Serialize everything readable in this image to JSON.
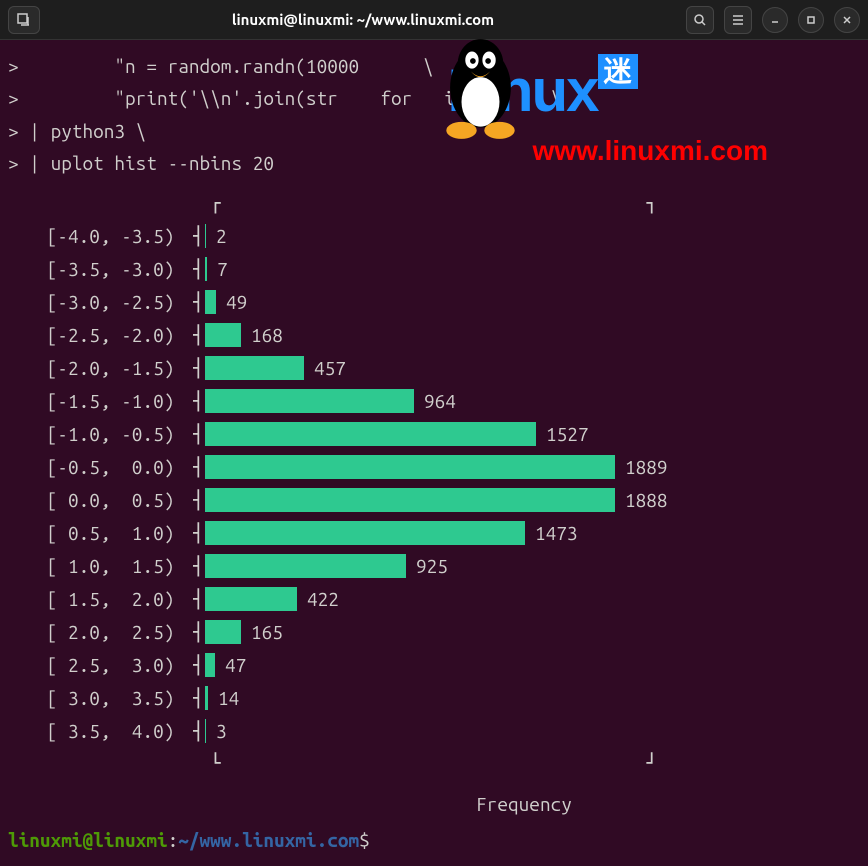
{
  "titlebar": {
    "title": "linuxmi@linuxmi: ~/www.linuxmi.com"
  },
  "watermark": {
    "text_linux": "Linux",
    "text_mi": "迷",
    "url": "www.linuxmi.com"
  },
  "commands": {
    "line1_prefix": ">         ",
    "line1": "\"n = random.randn(10000      \\",
    "line2_prefix": ">         ",
    "line2": "\"print('\\\\n'.join(str    for   in  n     \\",
    "line3_prefix": "> | ",
    "line3": "python3 \\",
    "line4_prefix": "> | ",
    "line4": "uplot hist --nbins 20"
  },
  "chart_data": {
    "type": "bar",
    "orientation": "horizontal",
    "xlabel": "Frequency",
    "bar_color": "#2ec990",
    "max_value": 1889,
    "bins": [
      {
        "label": "[-4.0, -3.5)",
        "value": 2
      },
      {
        "label": "[-3.5, -3.0)",
        "value": 7
      },
      {
        "label": "[-3.0, -2.5)",
        "value": 49
      },
      {
        "label": "[-2.5, -2.0)",
        "value": 168
      },
      {
        "label": "[-2.0, -1.5)",
        "value": 457
      },
      {
        "label": "[-1.5, -1.0)",
        "value": 964
      },
      {
        "label": "[-1.0, -0.5)",
        "value": 1527
      },
      {
        "label": "[-0.5,  0.0)",
        "value": 1889
      },
      {
        "label": "[ 0.0,  0.5)",
        "value": 1888
      },
      {
        "label": "[ 0.5,  1.0)",
        "value": 1473
      },
      {
        "label": "[ 1.0,  1.5)",
        "value": 925
      },
      {
        "label": "[ 1.5,  2.0)",
        "value": 422
      },
      {
        "label": "[ 2.0,  2.5)",
        "value": 165
      },
      {
        "label": "[ 2.5,  3.0)",
        "value": 47
      },
      {
        "label": "[ 3.0,  3.5)",
        "value": 14
      },
      {
        "label": "[ 3.5,  4.0)",
        "value": 3
      }
    ]
  },
  "prompt": {
    "user_host": "linuxmi@linuxmi",
    "colon": ":",
    "path": "~/www.linuxmi.com",
    "symbol": "$"
  }
}
